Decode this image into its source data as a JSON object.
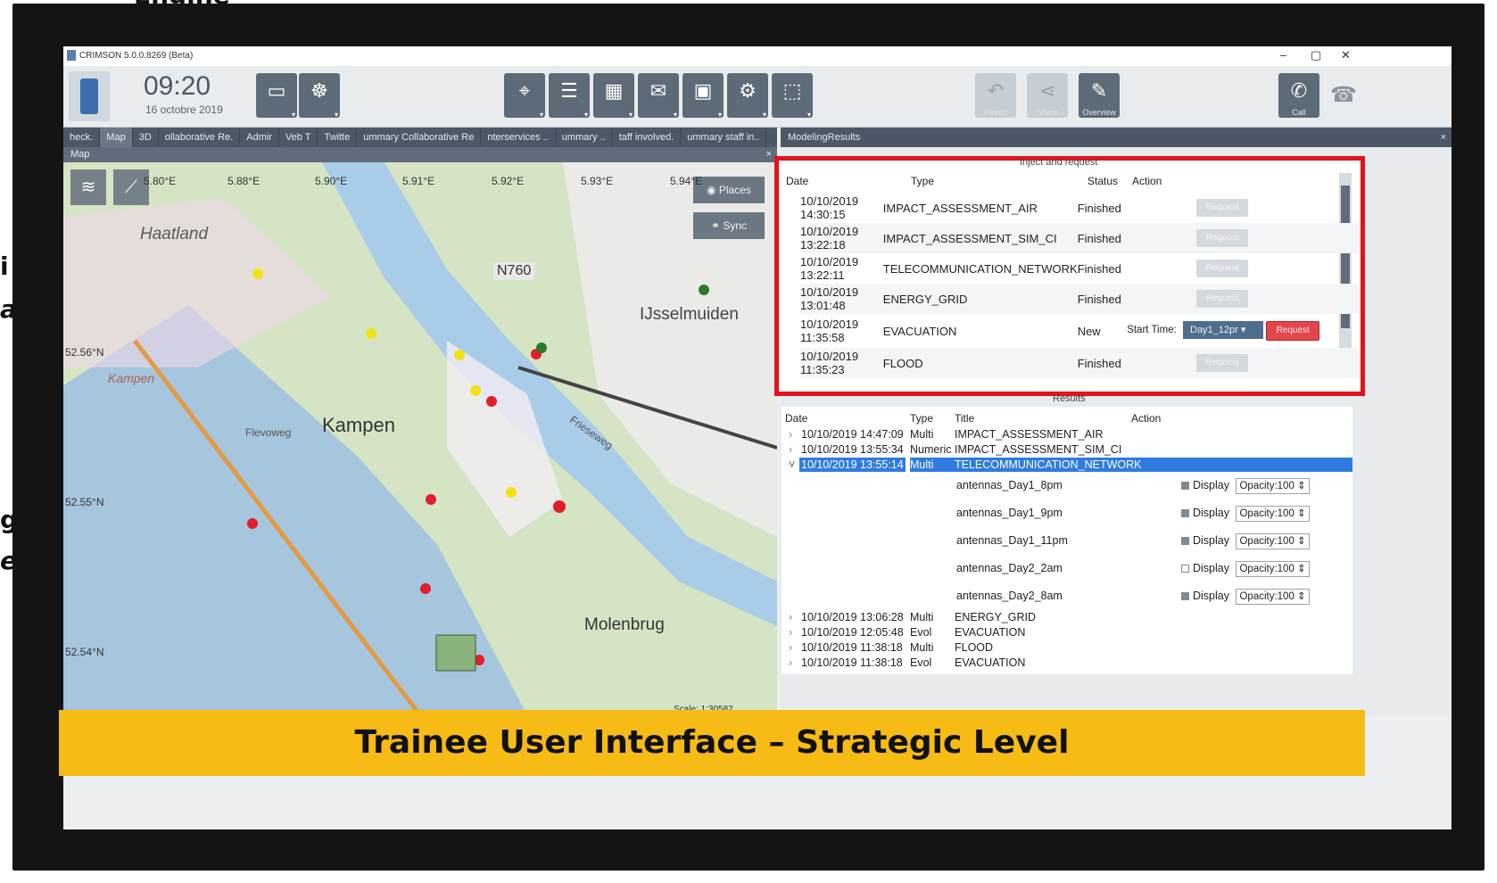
{
  "slide": {
    "corner_text_top": "Engine",
    "left_fragments": [
      "i",
      "a",
      "g",
      "e"
    ]
  },
  "window": {
    "title": "CRIMSON 5.0.0.8269 (Beta)",
    "controls": {
      "minimize": "–",
      "restore": "▢",
      "close": "✕"
    }
  },
  "toolbar": {
    "time": "09:20",
    "date": "16 octobre 2019",
    "buttons_right": [
      {
        "label": "Revert",
        "icon": "undo-icon"
      },
      {
        "label": "Share",
        "icon": "share-icon"
      },
      {
        "label": "Overview",
        "icon": "pencil-icon"
      }
    ],
    "call_label": "Call"
  },
  "tabs": [
    "heck.",
    "Map",
    "3D",
    "ollaborative Re.",
    "Admir",
    "Veb T",
    "Twitte",
    "ummary Collaborative Re",
    "nterservices ..",
    "ummary ..",
    "taff involved.",
    "ummary staff in.."
  ],
  "map": {
    "header": "Map",
    "places_label": "Places",
    "sync_label": "Sync",
    "longitudes": [
      "5.80°E",
      "5.88°E",
      "5.90°E",
      "5.91°E",
      "5.92°E",
      "5.93°E",
      "5.94°E"
    ],
    "latitudes": [
      "52.56°N",
      "52.55°N",
      "52.54°N"
    ],
    "road_label": "N760",
    "places": [
      "Haatland",
      "IJsselmuiden",
      "Kampen",
      "Molenbrug",
      "Kampen",
      "Frieseweg",
      "Flevoweg"
    ],
    "scale_text": "Scale: 1:30582"
  },
  "modeling": {
    "header": "ModelingResults",
    "inject_title": "Inject and request",
    "inject_columns": [
      "Date",
      "Type",
      "Status",
      "Action"
    ],
    "inject_rows": [
      {
        "date": "10/10/2019 14:30:15",
        "type": "IMPACT_ASSESSMENT_AIR",
        "status": "Finished",
        "action": "Request"
      },
      {
        "date": "10/10/2019 13:22:18",
        "type": "IMPACT_ASSESSMENT_SIM_CI",
        "status": "Finished",
        "action": "Request"
      },
      {
        "date": "10/10/2019 13:22:11",
        "type": "TELECOMMUNICATION_NETWORK",
        "status": "Finished",
        "action": "Request"
      },
      {
        "date": "10/10/2019 13:01:48",
        "type": "ENERGY_GRID",
        "status": "Finished",
        "action": "Request"
      },
      {
        "date": "10/10/2019 11:35:58",
        "type": "EVACUATION",
        "status": "New",
        "start_time_label": "Start Time:",
        "start_time_value": "Day1_12pr",
        "action": "Request"
      },
      {
        "date": "10/10/2019 11:35:23",
        "type": "FLOOD",
        "status": "Finished",
        "action": "Request"
      }
    ],
    "results_title": "Results",
    "results_columns": [
      "Date",
      "Type",
      "Title",
      "Action"
    ],
    "results_top": [
      {
        "toggle": "›",
        "date": "10/10/2019 14:47:09",
        "type": "Multi",
        "title": "IMPACT_ASSESSMENT_AIR"
      },
      {
        "toggle": "›",
        "date": "10/10/2019 13:55:34",
        "type": "Numeric",
        "title": "IMPACT_ASSESSMENT_SIM_CI"
      },
      {
        "toggle": "˅",
        "date": "10/10/2019 13:55:14",
        "type": "Multi",
        "title": "TELECOMMUNICATION_NETWORK"
      }
    ],
    "layers": [
      {
        "name": "antennas_Day1_8pm",
        "display": "Display",
        "opacity": "Opacity:100",
        "checked": false
      },
      {
        "name": "antennas_Day1_9pm",
        "display": "Display",
        "opacity": "Opacity:100",
        "checked": false
      },
      {
        "name": "antennas_Day1_11pm",
        "display": "Display",
        "opacity": "Opacity:100",
        "checked": false
      },
      {
        "name": "antennas_Day2_2am",
        "display": "Display",
        "opacity": "Opacity:100",
        "checked": true
      },
      {
        "name": "antennas_Day2_8am",
        "display": "Display",
        "opacity": "Opacity:100",
        "checked": false
      }
    ],
    "results_bottom": [
      {
        "toggle": "›",
        "date": "10/10/2019 13:06:28",
        "type": "Multi",
        "title": "ENERGY_GRID"
      },
      {
        "toggle": "›",
        "date": "10/10/2019 12:05:48",
        "type": "Evol",
        "title": "EVACUATION"
      },
      {
        "toggle": "›",
        "date": "10/10/2019 11:38:18",
        "type": "Multi",
        "title": "FLOOD"
      },
      {
        "toggle": "›",
        "date": "10/10/2019 11:38:18",
        "type": "Evol",
        "title": "EVACUATION"
      }
    ]
  },
  "banner": "Trainee User Interface – Strategic Level",
  "colors": {
    "highlight_border": "#e4121b",
    "banner": "#f6bb15",
    "selected_row": "#2f7be0"
  }
}
